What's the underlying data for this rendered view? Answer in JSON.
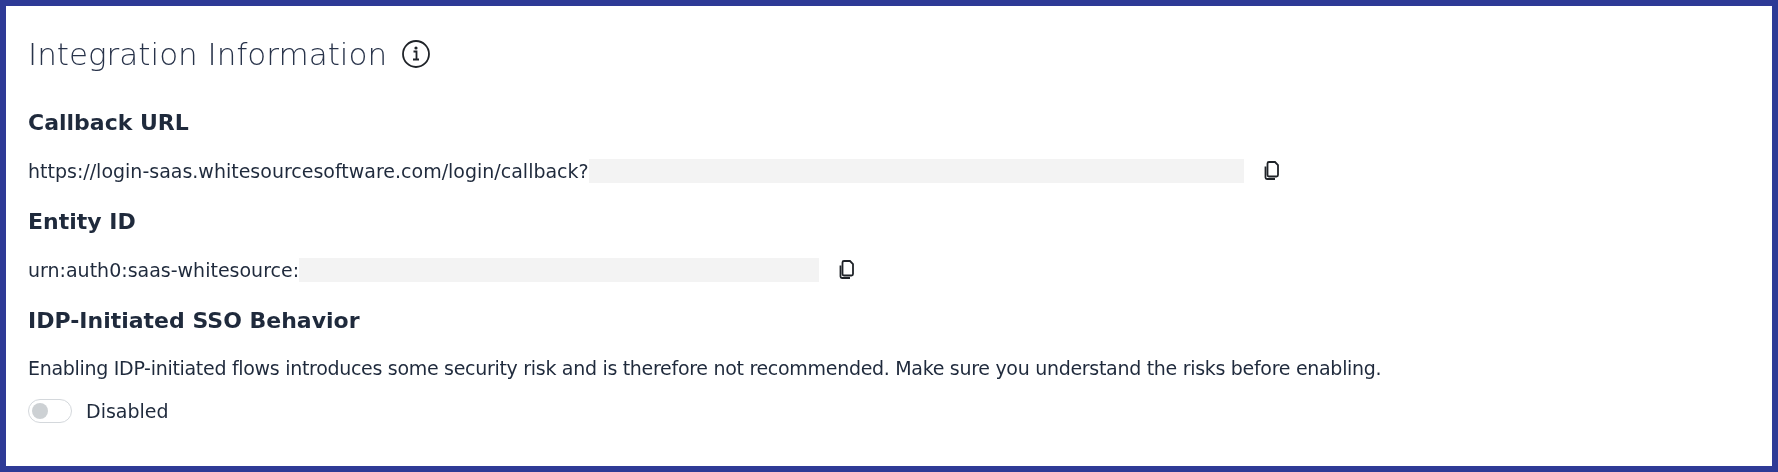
{
  "title": "Integration Information",
  "fields": [
    {
      "label": "Callback URL",
      "value": "https://login-saas.whitesourcesoftware.com/login/callback?"
    },
    {
      "label": "Entity ID",
      "value": "urn:auth0:saas-whitesource:"
    }
  ],
  "sso": {
    "label": "IDP-Initiated SSO Behavior",
    "description": "Enabling IDP-initiated flows introduces some security risk and is therefore not recommended. Make sure you understand the risks before enabling.",
    "toggle": {
      "on": false,
      "label": "Disabled"
    }
  }
}
